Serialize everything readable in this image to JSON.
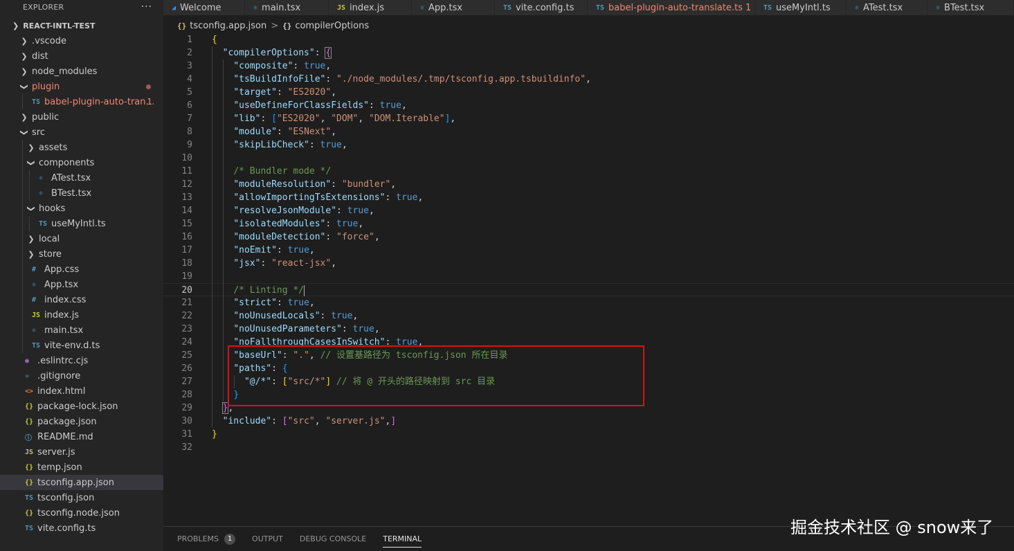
{
  "sidebar": {
    "header": "EXPLORER",
    "more": "···",
    "root": "REACT-INTL-TEST",
    "items": [
      {
        "name": ".vscode",
        "type": "folder",
        "depth": 1,
        "open": false
      },
      {
        "name": "dist",
        "type": "folder",
        "depth": 1,
        "open": false
      },
      {
        "name": "node_modules",
        "type": "folder",
        "depth": 1,
        "open": false
      },
      {
        "name": "plugin",
        "type": "folder",
        "depth": 1,
        "open": true,
        "error": true
      },
      {
        "name": "babel-plugin-auto-transl...",
        "type": "ts",
        "depth": 2,
        "error": true,
        "badge": "1"
      },
      {
        "name": "public",
        "type": "folder",
        "depth": 1,
        "open": false
      },
      {
        "name": "src",
        "type": "folder",
        "depth": 1,
        "open": true
      },
      {
        "name": "assets",
        "type": "folder",
        "depth": 2,
        "open": false
      },
      {
        "name": "components",
        "type": "folder",
        "depth": 2,
        "open": true
      },
      {
        "name": "ATest.tsx",
        "type": "react",
        "depth": 3
      },
      {
        "name": "BTest.tsx",
        "type": "react",
        "depth": 3
      },
      {
        "name": "hooks",
        "type": "folder",
        "depth": 2,
        "open": true
      },
      {
        "name": "useMyIntl.ts",
        "type": "ts",
        "depth": 3
      },
      {
        "name": "local",
        "type": "folder",
        "depth": 2,
        "open": false
      },
      {
        "name": "store",
        "type": "folder",
        "depth": 2,
        "open": false
      },
      {
        "name": "App.css",
        "type": "css",
        "depth": 2
      },
      {
        "name": "App.tsx",
        "type": "react",
        "depth": 2
      },
      {
        "name": "index.css",
        "type": "css",
        "depth": 2
      },
      {
        "name": "index.js",
        "type": "js",
        "depth": 2
      },
      {
        "name": "main.tsx",
        "type": "react",
        "depth": 2
      },
      {
        "name": "vite-env.d.ts",
        "type": "ts",
        "depth": 2
      },
      {
        "name": ".eslintrc.cjs",
        "type": "eslint",
        "depth": 1
      },
      {
        "name": ".gitignore",
        "type": "git",
        "depth": 1
      },
      {
        "name": "index.html",
        "type": "html",
        "depth": 1
      },
      {
        "name": "package-lock.json",
        "type": "json",
        "depth": 1
      },
      {
        "name": "package.json",
        "type": "json",
        "depth": 1
      },
      {
        "name": "README.md",
        "type": "info",
        "depth": 1
      },
      {
        "name": "server.js",
        "type": "js",
        "depth": 1
      },
      {
        "name": "temp.json",
        "type": "json",
        "depth": 1
      },
      {
        "name": "tsconfig.app.json",
        "type": "json",
        "depth": 1,
        "selected": true
      },
      {
        "name": "tsconfig.json",
        "type": "tsconfig",
        "depth": 1
      },
      {
        "name": "tsconfig.node.json",
        "type": "json",
        "depth": 1
      },
      {
        "name": "vite.config.ts",
        "type": "ts",
        "depth": 1
      }
    ]
  },
  "tabs": [
    {
      "label": "Welcome",
      "icon": "vscode",
      "width": 118
    },
    {
      "label": "main.tsx",
      "icon": "react",
      "width": 121
    },
    {
      "label": "index.js",
      "icon": "js",
      "width": 120
    },
    {
      "label": "App.tsx",
      "icon": "react",
      "width": 120
    },
    {
      "label": "vite.config.ts",
      "icon": "ts",
      "width": 134
    },
    {
      "label": "babel-plugin-auto-translate.ts",
      "icon": "ts",
      "width": 242,
      "error": true,
      "badge": "1"
    },
    {
      "label": "useMyIntl.ts",
      "icon": "ts",
      "width": 132
    },
    {
      "label": "ATest.tsx",
      "icon": "react",
      "width": 117
    },
    {
      "label": "BTest.tsx",
      "icon": "react",
      "width": 125
    }
  ],
  "breadcrumb": {
    "icon": "{}",
    "file": "tsconfig.app.json",
    "sep": ">",
    "symbol_icon": "{}",
    "symbol": "compilerOptions"
  },
  "editor": {
    "current_line": 20,
    "lines": [
      [
        [
          "{",
          "br1"
        ]
      ],
      [
        [
          "  ",
          "p"
        ],
        [
          "\"compilerOptions\"",
          "k"
        ],
        [
          ": ",
          "p"
        ],
        [
          "{",
          "br2 match"
        ]
      ],
      [
        [
          "    ",
          "p"
        ],
        [
          "\"composite\"",
          "k"
        ],
        [
          ": ",
          "p"
        ],
        [
          "true",
          "b"
        ],
        [
          ",",
          "p"
        ]
      ],
      [
        [
          "    ",
          "p"
        ],
        [
          "\"tsBuildInfoFile\"",
          "k"
        ],
        [
          ": ",
          "p"
        ],
        [
          "\"./node_modules/.tmp/tsconfig.app.tsbuildinfo\"",
          "s"
        ],
        [
          ",",
          "p"
        ]
      ],
      [
        [
          "    ",
          "p"
        ],
        [
          "\"target\"",
          "k"
        ],
        [
          ": ",
          "p"
        ],
        [
          "\"ES2020\"",
          "s"
        ],
        [
          ",",
          "p"
        ]
      ],
      [
        [
          "    ",
          "p"
        ],
        [
          "\"useDefineForClassFields\"",
          "k"
        ],
        [
          ": ",
          "p"
        ],
        [
          "true",
          "b"
        ],
        [
          ",",
          "p"
        ]
      ],
      [
        [
          "    ",
          "p"
        ],
        [
          "\"lib\"",
          "k"
        ],
        [
          ": ",
          "p"
        ],
        [
          "[",
          "br3"
        ],
        [
          "\"ES2020\"",
          "s"
        ],
        [
          ", ",
          "p"
        ],
        [
          "\"DOM\"",
          "s"
        ],
        [
          ", ",
          "p"
        ],
        [
          "\"DOM.Iterable\"",
          "s"
        ],
        [
          "]",
          "br3"
        ],
        [
          ",",
          "p"
        ]
      ],
      [
        [
          "    ",
          "p"
        ],
        [
          "\"module\"",
          "k"
        ],
        [
          ": ",
          "p"
        ],
        [
          "\"ESNext\"",
          "s"
        ],
        [
          ",",
          "p"
        ]
      ],
      [
        [
          "    ",
          "p"
        ],
        [
          "\"skipLibCheck\"",
          "k"
        ],
        [
          ": ",
          "p"
        ],
        [
          "true",
          "b"
        ],
        [
          ",",
          "p"
        ]
      ],
      [],
      [
        [
          "    ",
          "p"
        ],
        [
          "/* Bundler mode */",
          "c"
        ]
      ],
      [
        [
          "    ",
          "p"
        ],
        [
          "\"moduleResolution\"",
          "k"
        ],
        [
          ": ",
          "p"
        ],
        [
          "\"bundler\"",
          "s"
        ],
        [
          ",",
          "p"
        ]
      ],
      [
        [
          "    ",
          "p"
        ],
        [
          "\"allowImportingTsExtensions\"",
          "k"
        ],
        [
          ": ",
          "p"
        ],
        [
          "true",
          "b"
        ],
        [
          ",",
          "p"
        ]
      ],
      [
        [
          "    ",
          "p"
        ],
        [
          "\"resolveJsonModule\"",
          "k"
        ],
        [
          ": ",
          "p"
        ],
        [
          "true",
          "b"
        ],
        [
          ",",
          "p"
        ]
      ],
      [
        [
          "    ",
          "p"
        ],
        [
          "\"isolatedModules\"",
          "k"
        ],
        [
          ": ",
          "p"
        ],
        [
          "true",
          "b"
        ],
        [
          ",",
          "p"
        ]
      ],
      [
        [
          "    ",
          "p"
        ],
        [
          "\"moduleDetection\"",
          "k"
        ],
        [
          ": ",
          "p"
        ],
        [
          "\"force\"",
          "s"
        ],
        [
          ",",
          "p"
        ]
      ],
      [
        [
          "    ",
          "p"
        ],
        [
          "\"noEmit\"",
          "k"
        ],
        [
          ": ",
          "p"
        ],
        [
          "true",
          "b"
        ],
        [
          ",",
          "p"
        ]
      ],
      [
        [
          "    ",
          "p"
        ],
        [
          "\"jsx\"",
          "k"
        ],
        [
          ": ",
          "p"
        ],
        [
          "\"react-jsx\"",
          "s"
        ],
        [
          ",",
          "p"
        ]
      ],
      [],
      [
        [
          "    ",
          "p"
        ],
        [
          "/* Linting */",
          "c"
        ],
        [
          "|cursor|",
          "cursor"
        ]
      ],
      [
        [
          "    ",
          "p"
        ],
        [
          "\"strict\"",
          "k"
        ],
        [
          ": ",
          "p"
        ],
        [
          "true",
          "b"
        ],
        [
          ",",
          "p"
        ]
      ],
      [
        [
          "    ",
          "p"
        ],
        [
          "\"noUnusedLocals\"",
          "k"
        ],
        [
          ": ",
          "p"
        ],
        [
          "true",
          "b"
        ],
        [
          ",",
          "p"
        ]
      ],
      [
        [
          "    ",
          "p"
        ],
        [
          "\"noUnusedParameters\"",
          "k"
        ],
        [
          ": ",
          "p"
        ],
        [
          "true",
          "b"
        ],
        [
          ",",
          "p"
        ]
      ],
      [
        [
          "    ",
          "p"
        ],
        [
          "\"noFallthroughCasesInSwitch\"",
          "k"
        ],
        [
          ": ",
          "p"
        ],
        [
          "true",
          "b"
        ],
        [
          ",",
          "p"
        ]
      ],
      [
        [
          "    ",
          "p"
        ],
        [
          "\"baseUrl\"",
          "k"
        ],
        [
          ": ",
          "p"
        ],
        [
          "\".\"",
          "s"
        ],
        [
          ", ",
          "p"
        ],
        [
          "// 设置基路径为 tsconfig.json 所在目录",
          "c"
        ]
      ],
      [
        [
          "    ",
          "p"
        ],
        [
          "\"paths\"",
          "k"
        ],
        [
          ": ",
          "p"
        ],
        [
          "{",
          "br3"
        ]
      ],
      [
        [
          "      ",
          "p"
        ],
        [
          "\"@/*\"",
          "k"
        ],
        [
          ": ",
          "p"
        ],
        [
          "[",
          "br1"
        ],
        [
          "\"src/*\"",
          "s"
        ],
        [
          "]",
          "br1"
        ],
        [
          " ",
          "p"
        ],
        [
          "// 将 @ 开头的路径映射到 src 目录",
          "c"
        ]
      ],
      [
        [
          "    ",
          "p"
        ],
        [
          "}",
          "br3"
        ]
      ],
      [
        [
          "  ",
          "p"
        ],
        [
          "}",
          "br2 match"
        ],
        [
          ",",
          "p"
        ]
      ],
      [
        [
          "  ",
          "p"
        ],
        [
          "\"include\"",
          "k"
        ],
        [
          ": ",
          "p"
        ],
        [
          "[",
          "br2"
        ],
        [
          "\"src\"",
          "s"
        ],
        [
          ", ",
          "p"
        ],
        [
          "\"server.js\"",
          "s"
        ],
        [
          ",",
          "p"
        ],
        [
          "]",
          "br2"
        ]
      ],
      [
        [
          "}",
          "br1"
        ]
      ],
      []
    ]
  },
  "panel": {
    "tabs": [
      {
        "label": "PROBLEMS",
        "count": "1"
      },
      {
        "label": "OUTPUT"
      },
      {
        "label": "DEBUG CONSOLE"
      },
      {
        "label": "TERMINAL",
        "active": true
      }
    ]
  },
  "watermark": "掘金技术社区 @ snow来了",
  "colors": {
    "accent": "#007acc",
    "error": "#f48771",
    "highlight_box": "#e01010"
  }
}
